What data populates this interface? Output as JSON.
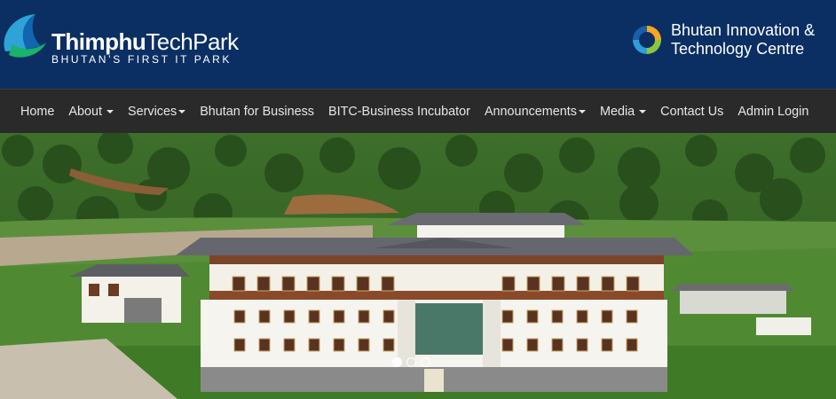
{
  "header": {
    "brand_name_bold": "Thimphu",
    "brand_name_light": "TechPark",
    "brand_tagline": "BHUTAN’S FIRST IT PARK",
    "partner_name_line1": "Bhutan Innovation &",
    "partner_name_line2": "Technology Centre",
    "background_color": "#0b2f63"
  },
  "nav": {
    "background_color": "#2a2a2a",
    "items": [
      {
        "label": "Home",
        "dropdown": false
      },
      {
        "label": "About",
        "dropdown": true
      },
      {
        "label": "Services",
        "dropdown": true
      },
      {
        "label": "Bhutan for Business",
        "dropdown": false
      },
      {
        "label": "BITC-Business Incubator",
        "dropdown": false
      },
      {
        "label": "Announcements",
        "dropdown": true
      },
      {
        "label": "Media",
        "dropdown": true
      },
      {
        "label": "Contact Us",
        "dropdown": false
      },
      {
        "label": "Admin Login",
        "dropdown": false
      }
    ]
  },
  "carousel": {
    "slide_count": 3,
    "active_slide": 1
  }
}
